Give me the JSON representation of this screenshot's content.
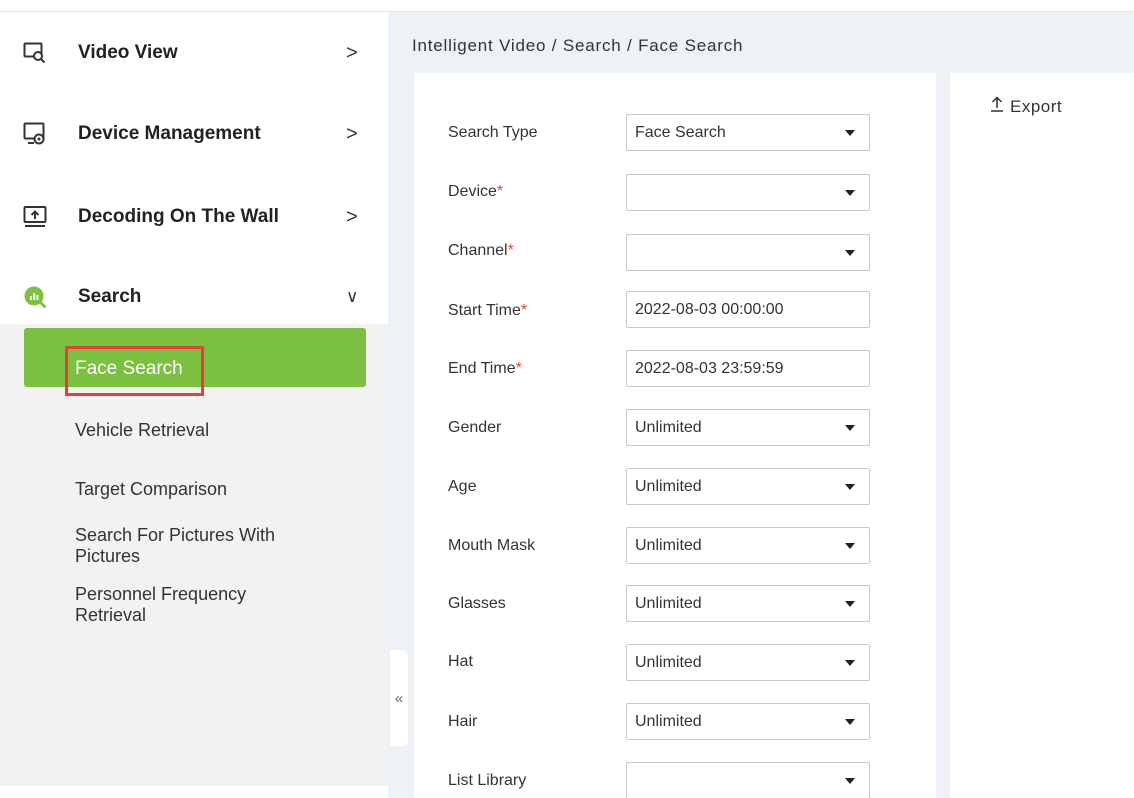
{
  "breadcrumb": "Intelligent Video / Search / Face Search",
  "sidebar": {
    "items": [
      {
        "label": "Video View",
        "icon": "video-search-icon",
        "chevron": ">"
      },
      {
        "label": "Device Management",
        "icon": "device-settings-icon",
        "chevron": ">"
      },
      {
        "label": "Decoding On The Wall",
        "icon": "monitor-upload-icon",
        "chevron": ">"
      },
      {
        "label": "Search",
        "icon": "search-chart-icon",
        "chevron": "∨"
      }
    ],
    "sub_items": [
      {
        "label": "Face Search",
        "active": true
      },
      {
        "label": "Vehicle Retrieval"
      },
      {
        "label": "Target Comparison"
      },
      {
        "label": "Search For Pictures With Pictures"
      },
      {
        "label": "Personnel Frequency Retrieval"
      }
    ],
    "collapse_glyph": "«",
    "accent_color": "#7cc042",
    "highlight_color": "#e4413a"
  },
  "form": {
    "fields": [
      {
        "label": "Search Type",
        "required": false,
        "value": "Face Search",
        "type": "select"
      },
      {
        "label": "Device",
        "required": true,
        "value": "",
        "type": "select"
      },
      {
        "label": "Channel",
        "required": true,
        "value": "",
        "type": "select"
      },
      {
        "label": "Start Time",
        "required": true,
        "value": "2022-08-03 00:00:00",
        "type": "datetime"
      },
      {
        "label": "End Time",
        "required": true,
        "value": "2022-08-03 23:59:59",
        "type": "datetime"
      },
      {
        "label": "Gender",
        "required": false,
        "value": "Unlimited",
        "type": "select"
      },
      {
        "label": "Age",
        "required": false,
        "value": "Unlimited",
        "type": "select"
      },
      {
        "label": "Mouth Mask",
        "required": false,
        "value": "Unlimited",
        "type": "select"
      },
      {
        "label": "Glasses",
        "required": false,
        "value": "Unlimited",
        "type": "select"
      },
      {
        "label": "Hat",
        "required": false,
        "value": "Unlimited",
        "type": "select"
      },
      {
        "label": "Hair",
        "required": false,
        "value": "Unlimited",
        "type": "select"
      },
      {
        "label": "List Library",
        "required": false,
        "value": "",
        "type": "select"
      }
    ],
    "required_mark": "*"
  },
  "toolbar": {
    "export_label": "Export",
    "export_icon": "upload-arrow-icon"
  }
}
